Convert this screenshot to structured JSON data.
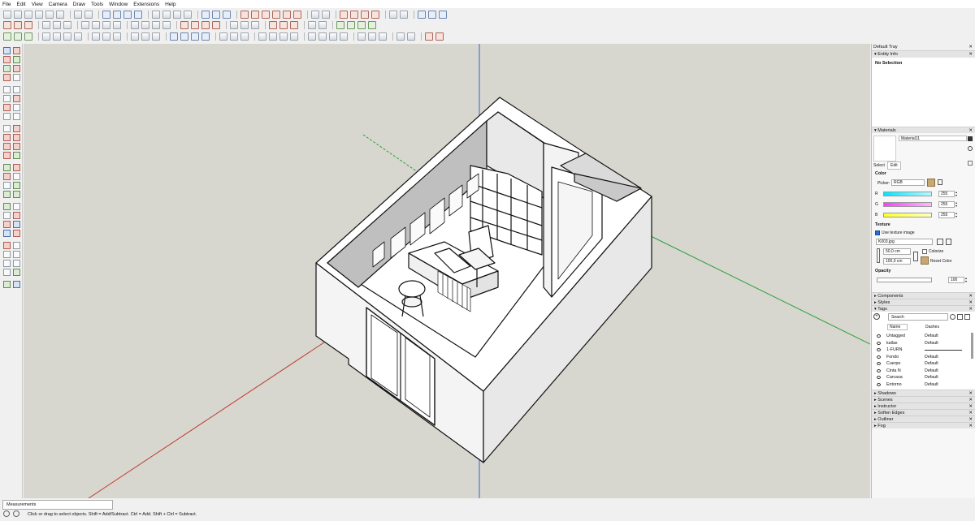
{
  "menu": [
    "File",
    "Edit",
    "View",
    "Camera",
    "Draw",
    "Tools",
    "Window",
    "Extensions",
    "Help"
  ],
  "tray": {
    "title": "Default Tray",
    "close_glyph": "✕",
    "entity_info": {
      "header": "Entity Info",
      "value": "No Selection"
    },
    "materials": {
      "header": "Materials",
      "material_name": "Material11",
      "tab_select": "Select",
      "tab_edit": "Edit",
      "color_label": "Color",
      "picker_label": "Picker:",
      "picker_value": "RGB",
      "channels": [
        {
          "label": "R",
          "value": "255",
          "color": "#00e5ff"
        },
        {
          "label": "G",
          "value": "255",
          "color": "#ff3dff"
        },
        {
          "label": "B",
          "value": "255",
          "color": "#ffff2a"
        }
      ],
      "texture_label": "Texture",
      "use_texture_label": "Use texture image",
      "texture_file": "K003.jpg",
      "width_value": "50,0 cm",
      "height_value": "100,0 cm",
      "colorize_label": "Colorize",
      "reset_color_label": "Reset Color",
      "opacity_label": "Opacity",
      "opacity_value": "100",
      "swatch_color": "#c9a770"
    },
    "components_header": "Components",
    "styles_header": "Styles",
    "tags": {
      "header": "Tags",
      "search_placeholder": "Search",
      "col_name": "Name",
      "col_dashes": "Dashes",
      "rows": [
        {
          "name": "Untagged",
          "dashes": "Default"
        },
        {
          "name": "kallax",
          "dashes": "Default"
        },
        {
          "name": "1-FURN",
          "dashes": ""
        },
        {
          "name": "Fondo",
          "dashes": "Default"
        },
        {
          "name": "Cuerpo",
          "dashes": "Default"
        },
        {
          "name": "Cinta N",
          "dashes": "Default"
        },
        {
          "name": "Carcasa",
          "dashes": "Default"
        },
        {
          "name": "Entorno",
          "dashes": "Default"
        }
      ]
    },
    "bottom_sections": [
      "Shadows",
      "Scenes",
      "Instructor",
      "Soften Edges",
      "Outliner",
      "Fog"
    ]
  },
  "status": {
    "measurements_label": "Measurements",
    "hint": "Click or drag to select objects. Shift = Add/Subtract. Ctrl = Add. Shift + Ctrl = Subtract."
  },
  "colors": {
    "background": "#d7d7cf",
    "axis_red": "#c0392b",
    "axis_green": "#2e9e3e",
    "axis_blue": "#3b64d0"
  }
}
